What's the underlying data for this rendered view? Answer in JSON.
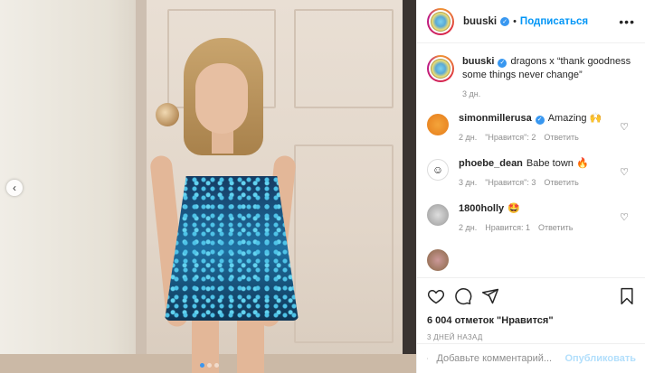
{
  "post": {
    "username": "buuski",
    "separator": "•",
    "follow_label": "Подписаться",
    "more_label": "•••",
    "carousel_prev": "‹"
  },
  "caption": {
    "username": "buuski",
    "text": "dragons x “thank goodness some things never change”",
    "time": "3 дн."
  },
  "comments": [
    {
      "username": "simonmillerusa",
      "verified": true,
      "text": "Amazing 🙌",
      "time": "2 дн.",
      "likes_label": "\"Нравится\": 2",
      "reply_label": "Ответить"
    },
    {
      "username": "phoebe_dean",
      "verified": false,
      "text": "Babe town 🔥",
      "time": "3 дн.",
      "likes_label": "\"Нравится\": 3",
      "reply_label": "Ответить"
    },
    {
      "username": "1800holly",
      "verified": false,
      "text": "🤩",
      "time": "2 дн.",
      "likes_label": "Нравится: 1",
      "reply_label": "Ответить"
    }
  ],
  "actions": {
    "likes_count": "6 004 отметок \"Нравится\"",
    "time_ago": "3 ДНЕЙ НАЗАД"
  },
  "composer": {
    "placeholder": "Добавьте комментарий...",
    "publish_label": "Опубликовать"
  },
  "icons": {
    "like": "heart-icon",
    "comment": "comment-icon",
    "share": "paper-plane-icon",
    "save": "bookmark-icon"
  },
  "colors": {
    "follow": "#0095f6",
    "verified": "#3897f0",
    "publish_disabled": "#b2dffc"
  }
}
